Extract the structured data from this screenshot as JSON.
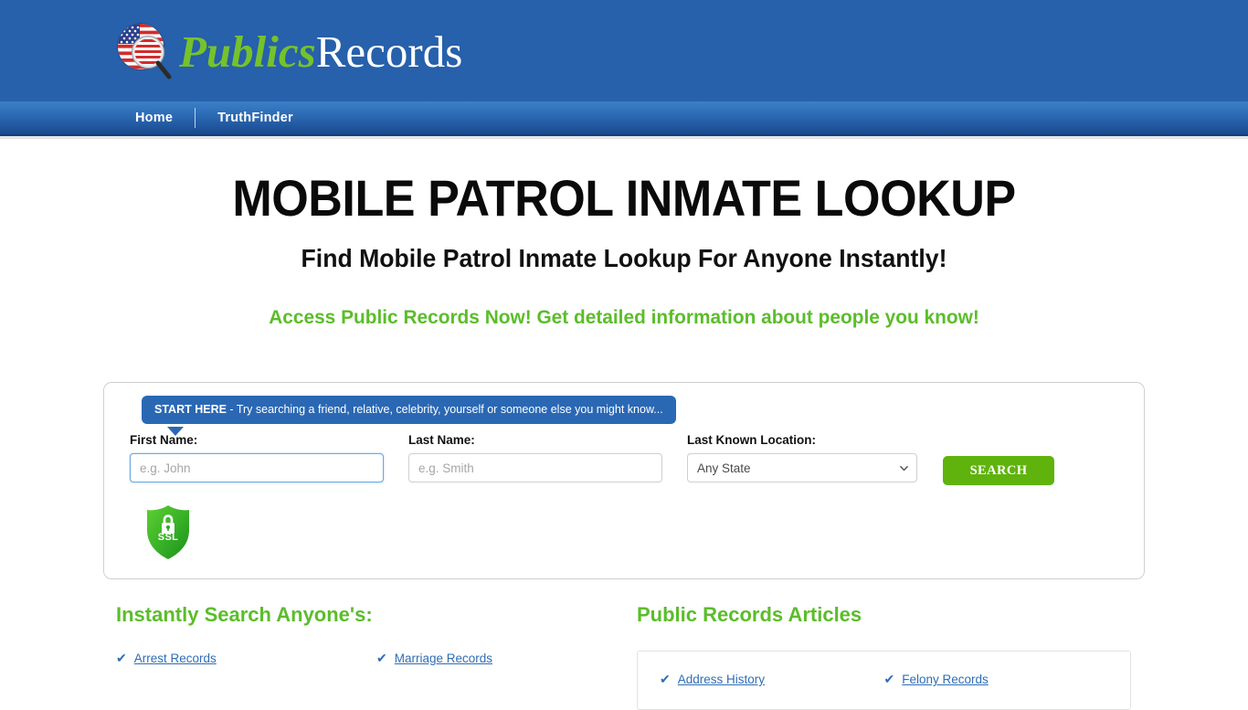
{
  "header": {
    "logo_icon": "us-flag-magnifier-icon",
    "logo_part1": "Publics",
    "logo_part2": "Records",
    "brand_green": "#76c22b",
    "brand_blue": "#2760ab"
  },
  "nav": {
    "items": [
      {
        "label": "Home"
      },
      {
        "label": "TruthFinder"
      }
    ]
  },
  "hero": {
    "title": "MOBILE PATROL INMATE LOOKUP",
    "subtitle": "Find Mobile Patrol Inmate Lookup For Anyone Instantly!",
    "tagline": "Access Public Records Now! Get detailed information about people you know!",
    "tagline_color": "#5bbd2a"
  },
  "search": {
    "tip_bold": "START HERE",
    "tip_rest": " - Try searching a friend, relative, celebrity, yourself or someone else you might know...",
    "first_name": {
      "label": "First Name:",
      "placeholder": "e.g. John",
      "value": ""
    },
    "last_name": {
      "label": "Last Name:",
      "placeholder": "e.g. Smith",
      "value": ""
    },
    "location": {
      "label": "Last Known Location:",
      "selected": "Any State",
      "options": [
        "Any State"
      ]
    },
    "submit_label": "SEARCH",
    "submit_color": "#5fb30c",
    "ssl_badge_label": "SSL",
    "ssl_icon": "padlock-shield-icon"
  },
  "left_column": {
    "title": "Instantly Search Anyone's:",
    "links": [
      {
        "label": "Arrest Records"
      },
      {
        "label": "Marriage Records"
      }
    ]
  },
  "right_column": {
    "title": "Public Records Articles",
    "links": [
      {
        "label": "Address History"
      },
      {
        "label": "Felony Records"
      }
    ]
  },
  "icons": {
    "check": "✔",
    "chevron_down": "chevron-down-icon"
  }
}
